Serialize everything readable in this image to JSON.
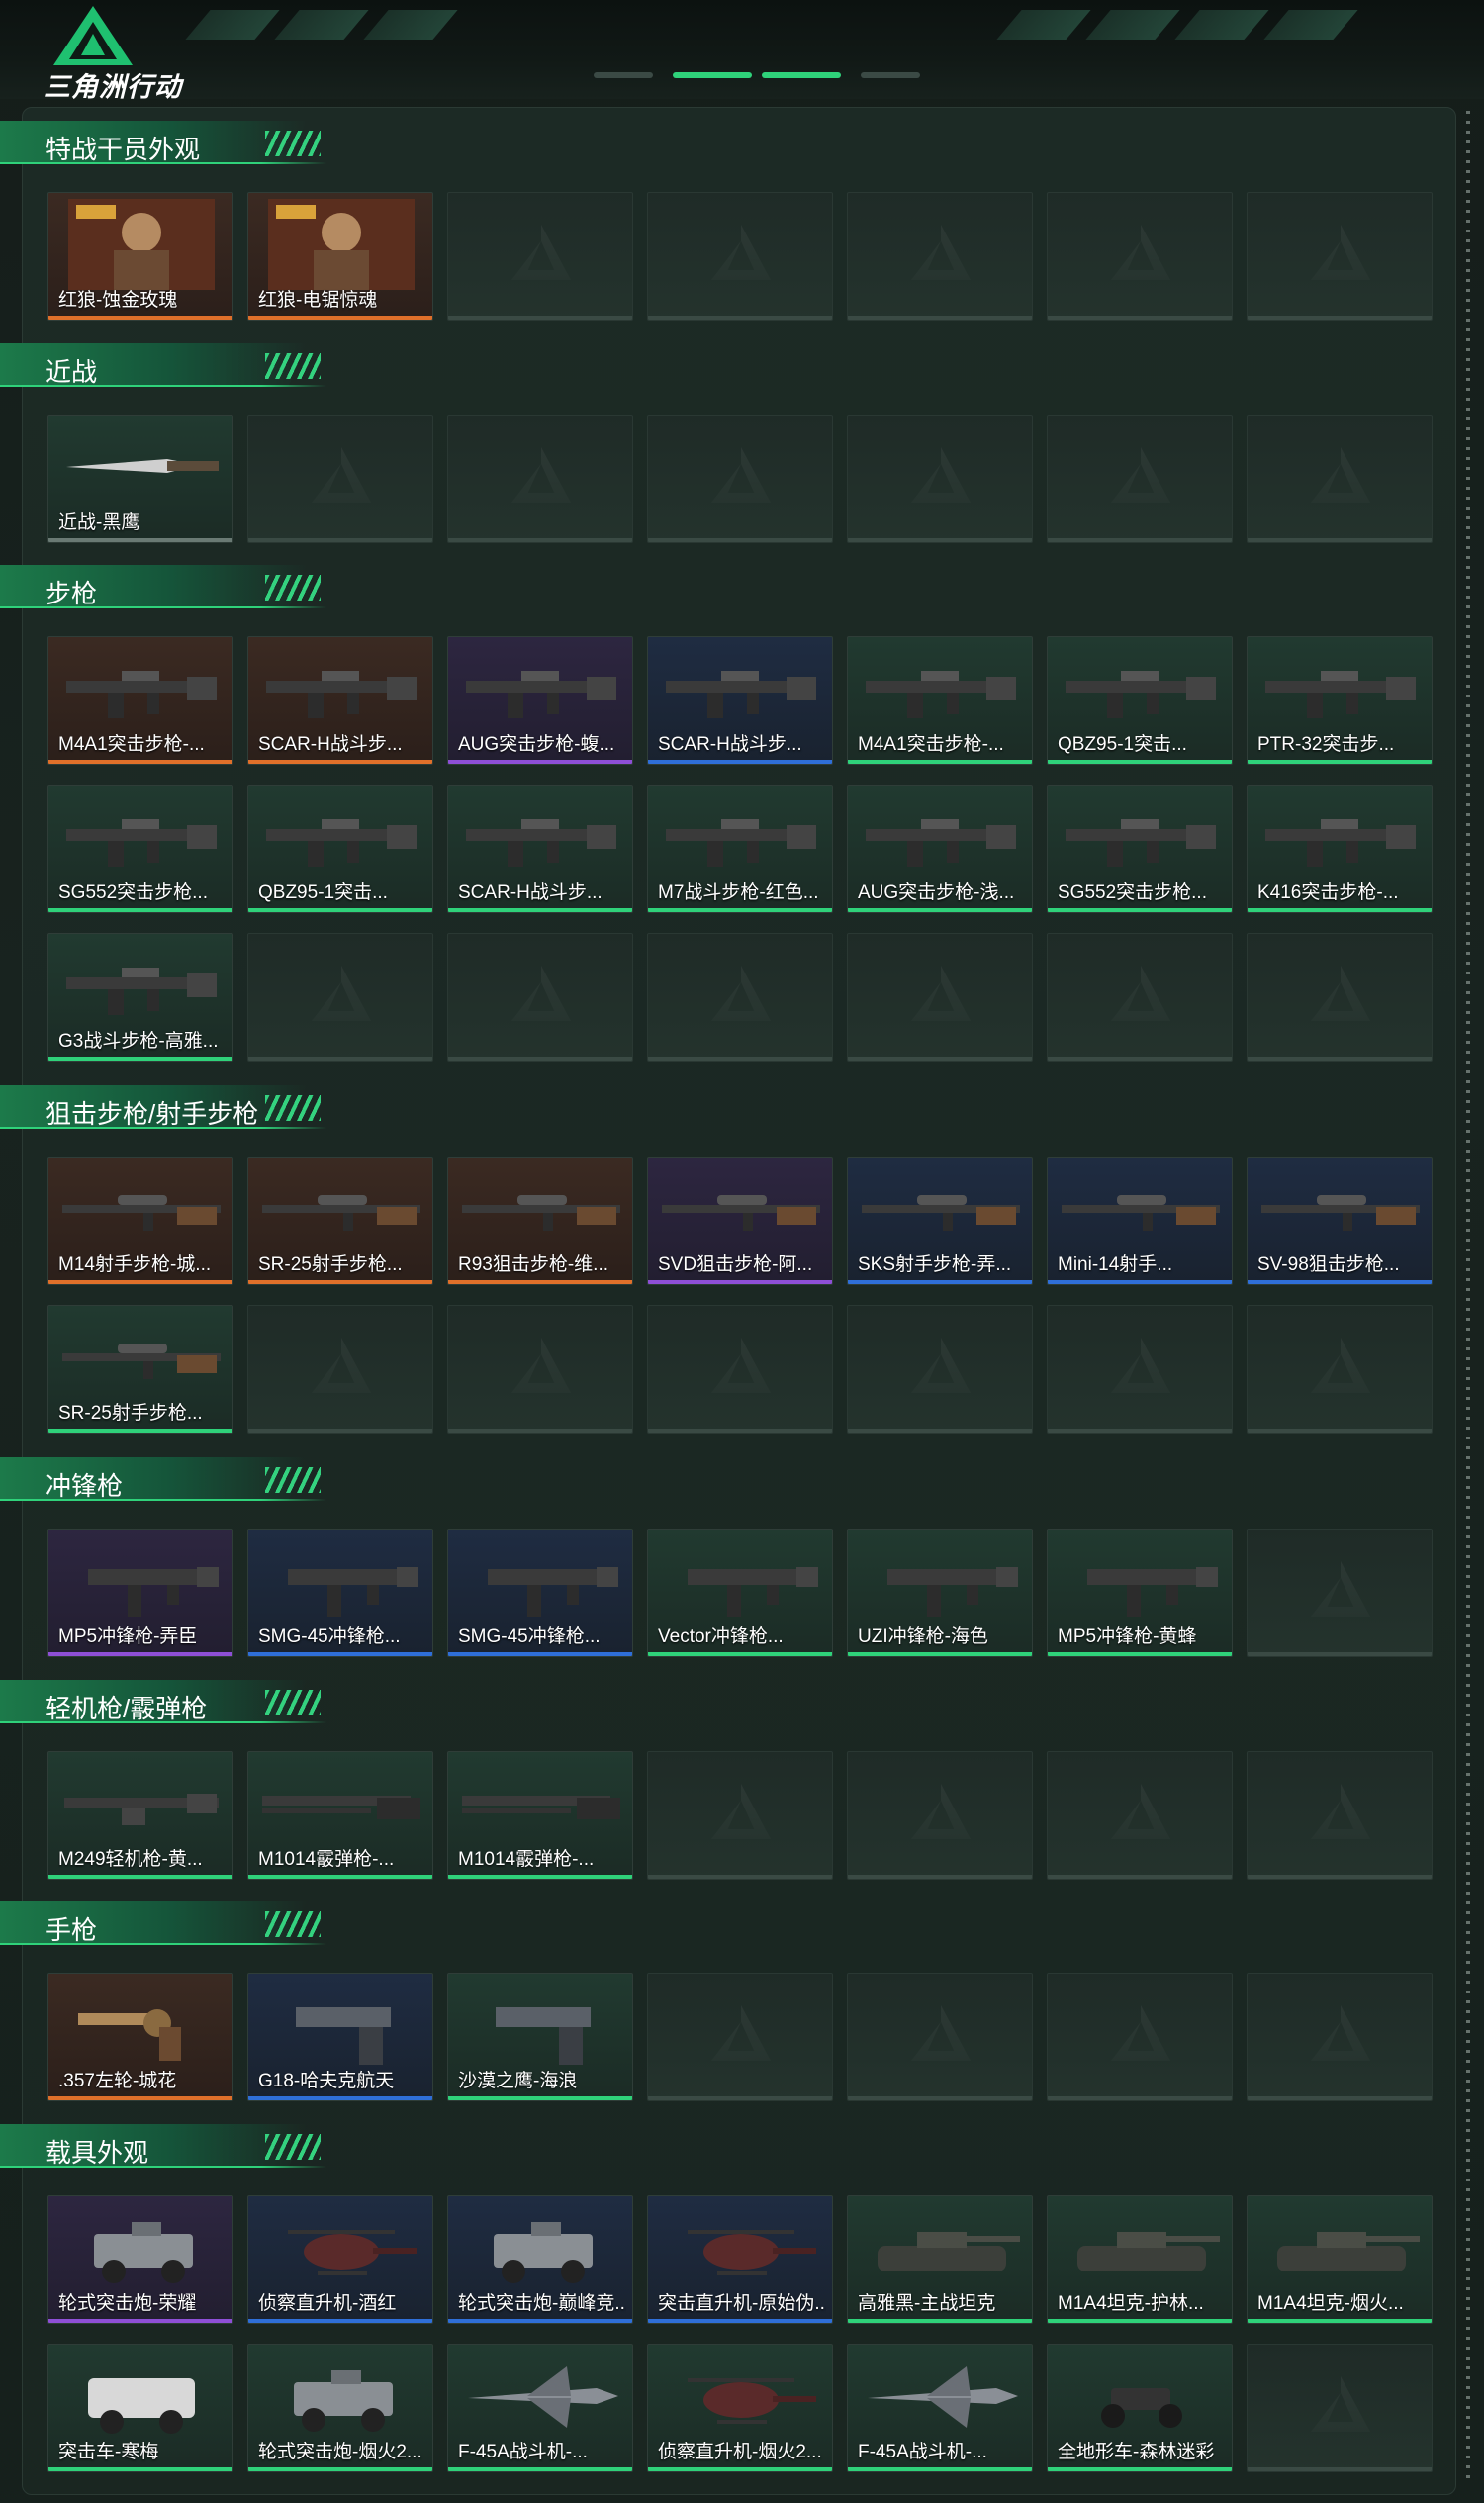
{
  "app": {
    "logo_text": "三角洲行动",
    "logo_icon": "delta-triangle-logo",
    "accent": "#2fd27a"
  },
  "rarity_colors": {
    "orange": "#e0702a",
    "purple": "#8e4fd6",
    "blue": "#2f6fd8",
    "green": "#2fd27a"
  },
  "sections": [
    {
      "title": "特战干员外观",
      "empty_slots": 5,
      "items": [
        {
          "label": "红狼-蚀金玫瑰",
          "rarity": "orange",
          "icon": "operator-portrait-icon"
        },
        {
          "label": "红狼-电锯惊魂",
          "rarity": "orange",
          "icon": "operator-portrait-icon"
        }
      ]
    },
    {
      "title": "近战",
      "empty_slots": 6,
      "items": [
        {
          "label": "近战-黑鹰",
          "rarity": "none",
          "icon": "knife-icon"
        }
      ]
    },
    {
      "title": "步枪",
      "empty_slots": 6,
      "items": [
        {
          "label": "M4A1突击步枪-...",
          "rarity": "orange",
          "icon": "rifle-icon"
        },
        {
          "label": "SCAR-H战斗步...",
          "rarity": "orange",
          "icon": "rifle-icon"
        },
        {
          "label": "AUG突击步枪-蝮...",
          "rarity": "purple",
          "icon": "rifle-icon"
        },
        {
          "label": "SCAR-H战斗步...",
          "rarity": "blue",
          "icon": "rifle-icon"
        },
        {
          "label": "M4A1突击步枪-...",
          "rarity": "green",
          "icon": "rifle-icon"
        },
        {
          "label": "QBZ95-1突击...",
          "rarity": "green",
          "icon": "rifle-icon"
        },
        {
          "label": "PTR-32突击步...",
          "rarity": "green",
          "icon": "rifle-icon"
        },
        {
          "label": "SG552突击步枪...",
          "rarity": "green",
          "icon": "rifle-icon"
        },
        {
          "label": "QBZ95-1突击...",
          "rarity": "green",
          "icon": "rifle-icon"
        },
        {
          "label": "SCAR-H战斗步...",
          "rarity": "green",
          "icon": "rifle-icon"
        },
        {
          "label": "M7战斗步枪-红色...",
          "rarity": "green",
          "icon": "rifle-icon"
        },
        {
          "label": "AUG突击步枪-浅...",
          "rarity": "green",
          "icon": "rifle-icon"
        },
        {
          "label": "SG552突击步枪...",
          "rarity": "green",
          "icon": "rifle-icon"
        },
        {
          "label": "K416突击步枪-...",
          "rarity": "green",
          "icon": "rifle-icon"
        },
        {
          "label": "G3战斗步枪-高雅...",
          "rarity": "green",
          "icon": "rifle-icon"
        }
      ]
    },
    {
      "title": "狙击步枪/射手步枪",
      "empty_slots": 6,
      "items": [
        {
          "label": "M14射手步枪-城...",
          "rarity": "orange",
          "icon": "sniper-rifle-icon"
        },
        {
          "label": "SR-25射手步枪...",
          "rarity": "orange",
          "icon": "sniper-rifle-icon"
        },
        {
          "label": "R93狙击步枪-维...",
          "rarity": "orange",
          "icon": "sniper-rifle-icon"
        },
        {
          "label": "SVD狙击步枪-阿...",
          "rarity": "purple",
          "icon": "sniper-rifle-icon"
        },
        {
          "label": "SKS射手步枪-弄...",
          "rarity": "blue",
          "icon": "sniper-rifle-icon"
        },
        {
          "label": "Mini-14射手...",
          "rarity": "blue",
          "icon": "sniper-rifle-icon"
        },
        {
          "label": "SV-98狙击步枪...",
          "rarity": "blue",
          "icon": "sniper-rifle-icon"
        },
        {
          "label": "SR-25射手步枪...",
          "rarity": "green",
          "icon": "sniper-rifle-icon"
        }
      ]
    },
    {
      "title": "冲锋枪",
      "empty_slots": 1,
      "items": [
        {
          "label": "MP5冲锋枪-弄臣",
          "rarity": "purple",
          "icon": "smg-icon"
        },
        {
          "label": "SMG-45冲锋枪...",
          "rarity": "blue",
          "icon": "smg-icon"
        },
        {
          "label": "SMG-45冲锋枪...",
          "rarity": "blue",
          "icon": "smg-icon"
        },
        {
          "label": "Vector冲锋枪...",
          "rarity": "green",
          "icon": "smg-icon"
        },
        {
          "label": "UZI冲锋枪-海色",
          "rarity": "green",
          "icon": "smg-icon"
        },
        {
          "label": "MP5冲锋枪-黄蜂",
          "rarity": "green",
          "icon": "smg-icon"
        }
      ]
    },
    {
      "title": "轻机枪/霰弹枪",
      "empty_slots": 4,
      "items": [
        {
          "label": "M249轻机枪-黄...",
          "rarity": "green",
          "icon": "lmg-icon"
        },
        {
          "label": "M1014霰弹枪-...",
          "rarity": "green",
          "icon": "shotgun-icon"
        },
        {
          "label": "M1014霰弹枪-...",
          "rarity": "green",
          "icon": "shotgun-icon"
        }
      ]
    },
    {
      "title": "手枪",
      "empty_slots": 4,
      "items": [
        {
          "label": ".357左轮-城花",
          "rarity": "orange",
          "icon": "revolver-icon"
        },
        {
          "label": "G18-哈夫克航天",
          "rarity": "blue",
          "icon": "pistol-icon"
        },
        {
          "label": "沙漠之鹰-海浪",
          "rarity": "green",
          "icon": "pistol-icon"
        }
      ]
    },
    {
      "title": "载具外观",
      "empty_slots": 1,
      "items": [
        {
          "label": "轮式突击炮-荣耀",
          "rarity": "purple",
          "icon": "armored-car-icon"
        },
        {
          "label": "侦察直升机-酒红",
          "rarity": "blue",
          "icon": "helicopter-icon"
        },
        {
          "label": "轮式突击炮-巅峰竞...",
          "rarity": "blue",
          "icon": "armored-car-icon"
        },
        {
          "label": "突击直升机-原始伪...",
          "rarity": "blue",
          "icon": "helicopter-icon"
        },
        {
          "label": "高雅黑-主战坦克",
          "rarity": "green",
          "icon": "tank-icon"
        },
        {
          "label": "M1A4坦克-护林...",
          "rarity": "green",
          "icon": "tank-icon"
        },
        {
          "label": "M1A4坦克-烟火...",
          "rarity": "green",
          "icon": "tank-icon"
        },
        {
          "label": "突击车-寒梅",
          "rarity": "green",
          "icon": "assault-vehicle-icon"
        },
        {
          "label": "轮式突击炮-烟火2...",
          "rarity": "green",
          "icon": "armored-car-icon"
        },
        {
          "label": "F-45A战斗机-...",
          "rarity": "green",
          "icon": "fighter-jet-icon"
        },
        {
          "label": "侦察直升机-烟火2...",
          "rarity": "green",
          "icon": "helicopter-icon"
        },
        {
          "label": "F-45A战斗机-...",
          "rarity": "green",
          "icon": "fighter-jet-icon"
        },
        {
          "label": "全地形车-森林迷彩",
          "rarity": "green",
          "icon": "atv-icon"
        }
      ]
    }
  ]
}
